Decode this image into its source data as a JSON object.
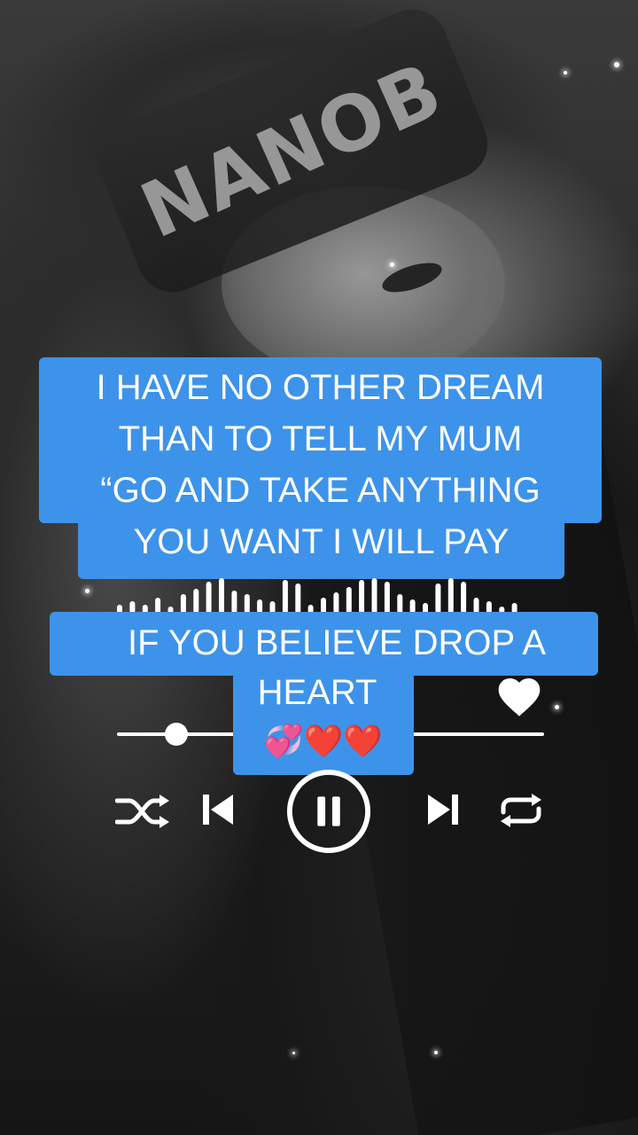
{
  "caption_top": {
    "lines": [
      "I HAVE NO OTHER DREAM",
      "THAN TO TELL MY MUM",
      "“GO AND TAKE ANYTHING",
      "YOU WANT I WILL PAY"
    ]
  },
  "caption_bottom": {
    "lines": [
      "IF YOU BELIEVE DROP A",
      "HEART",
      "💞❤️❤️"
    ]
  },
  "background": {
    "beanie_text": "NANOB"
  },
  "player": {
    "progress_fraction": 0.14,
    "liked": true,
    "controls": [
      "shuffle-icon",
      "previous-icon",
      "pause-icon",
      "next-icon",
      "repeat-icon"
    ]
  },
  "colors": {
    "caption_bg": "#3d93ea",
    "caption_text": "#ffffff",
    "controls": "#ffffff"
  }
}
